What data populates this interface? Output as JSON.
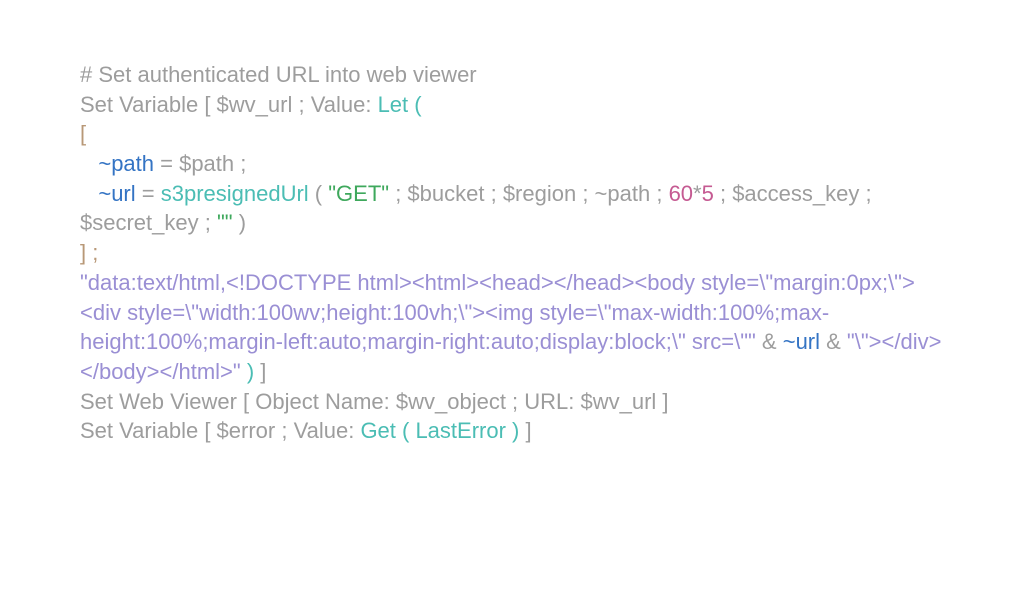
{
  "code": {
    "comment": "# Set authenticated URL into web viewer",
    "line2_a": "Set Variable [ $wv_url ; Value: ",
    "line2_b": "Let (",
    "bracket_open": "[",
    "indent": "   ",
    "tilde_path": "~path",
    "eq_path": " = $path ;",
    "tilde_url": "~url",
    "eq_url_a": " = ",
    "func_presigned": "s3presignedUrl",
    "eq_url_b": " ( ",
    "get_str": "\"GET\"",
    "eq_url_c": " ; $bucket ; $region ; ~path ; ",
    "num_60": "60",
    "star": "*",
    "num_5": "5",
    "eq_url_d": " ; $access_key ; $secret_key ; ",
    "empty_str": "\"\"",
    "eq_url_e": " )",
    "bracket_close_semi": "] ;",
    "html_str_1": "\"data:text/html,<!DOCTYPE html><html><head></head><body style=\\\"margin:0px;\\\"><div style=\\\"width:100wv;height:100vh;\\\"><img style=\\\"max-width:100%;max-height:100%;margin-left:auto;margin-right:auto;display:block;\\\" src=\\\"\"",
    "amp1": " & ",
    "tilde_url2": "~url",
    "amp2": " & ",
    "html_str_2": "\"\\\"></div></body></html>\"",
    "close_paren": " ) ",
    "close_bracket": "]",
    "line_webviewer": "Set Web Viewer [ Object Name: $wv_object ; URL: $wv_url ]",
    "line_last_a": "Set Variable [ $error ; Value: ",
    "line_last_b": "Get ( LastError )",
    "line_last_c": " ]"
  }
}
